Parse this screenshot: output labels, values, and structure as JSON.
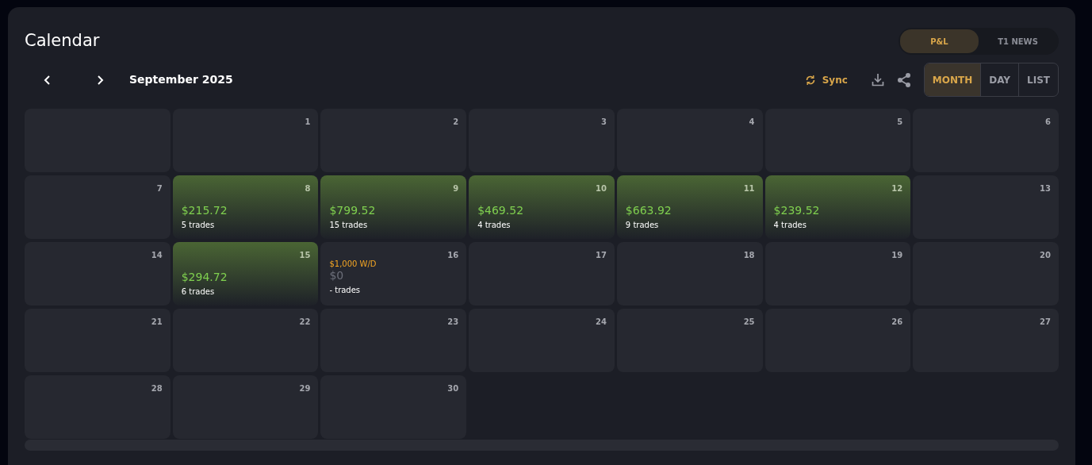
{
  "title": "Calendar",
  "tabs": [
    {
      "label": "P&L",
      "selected": true
    },
    {
      "label": "T1 NEWS",
      "selected": false
    }
  ],
  "month": "September 2025",
  "toolbar": {
    "sync": "Sync"
  },
  "views": [
    {
      "label": "MONTH",
      "selected": true
    },
    {
      "label": "DAY",
      "selected": false
    },
    {
      "label": "LIST",
      "selected": false
    }
  ],
  "days": [
    {
      "kind": "blank"
    },
    {
      "kind": "empty",
      "day": "1"
    },
    {
      "kind": "empty",
      "day": "2"
    },
    {
      "kind": "empty",
      "day": "3"
    },
    {
      "kind": "empty",
      "day": "4"
    },
    {
      "kind": "empty",
      "day": "5"
    },
    {
      "kind": "empty",
      "day": "6"
    },
    {
      "kind": "empty",
      "day": "7"
    },
    {
      "kind": "profit",
      "day": "8",
      "pnl": "$215.72",
      "trades": "5 trades"
    },
    {
      "kind": "profit",
      "day": "9",
      "pnl": "$799.52",
      "trades": "15 trades"
    },
    {
      "kind": "profit",
      "day": "10",
      "pnl": "$469.52",
      "trades": "4 trades"
    },
    {
      "kind": "profit",
      "day": "11",
      "pnl": "$663.92",
      "trades": "9 trades"
    },
    {
      "kind": "profit",
      "day": "12",
      "pnl": "$239.52",
      "trades": "4 trades"
    },
    {
      "kind": "empty",
      "day": "13"
    },
    {
      "kind": "empty",
      "day": "14"
    },
    {
      "kind": "profit",
      "day": "15",
      "pnl": "$294.72",
      "trades": "6 trades"
    },
    {
      "kind": "flat",
      "day": "16",
      "note": "$1,000 W/D",
      "pnl": "$0",
      "trades": "- trades"
    },
    {
      "kind": "empty",
      "day": "17"
    },
    {
      "kind": "empty",
      "day": "18"
    },
    {
      "kind": "empty",
      "day": "19"
    },
    {
      "kind": "empty",
      "day": "20"
    },
    {
      "kind": "empty",
      "day": "21"
    },
    {
      "kind": "empty",
      "day": "22"
    },
    {
      "kind": "empty",
      "day": "23"
    },
    {
      "kind": "empty",
      "day": "24"
    },
    {
      "kind": "empty",
      "day": "25"
    },
    {
      "kind": "empty",
      "day": "26"
    },
    {
      "kind": "empty",
      "day": "27"
    },
    {
      "kind": "empty",
      "day": "28"
    },
    {
      "kind": "empty",
      "day": "29"
    },
    {
      "kind": "empty",
      "day": "30"
    }
  ]
}
